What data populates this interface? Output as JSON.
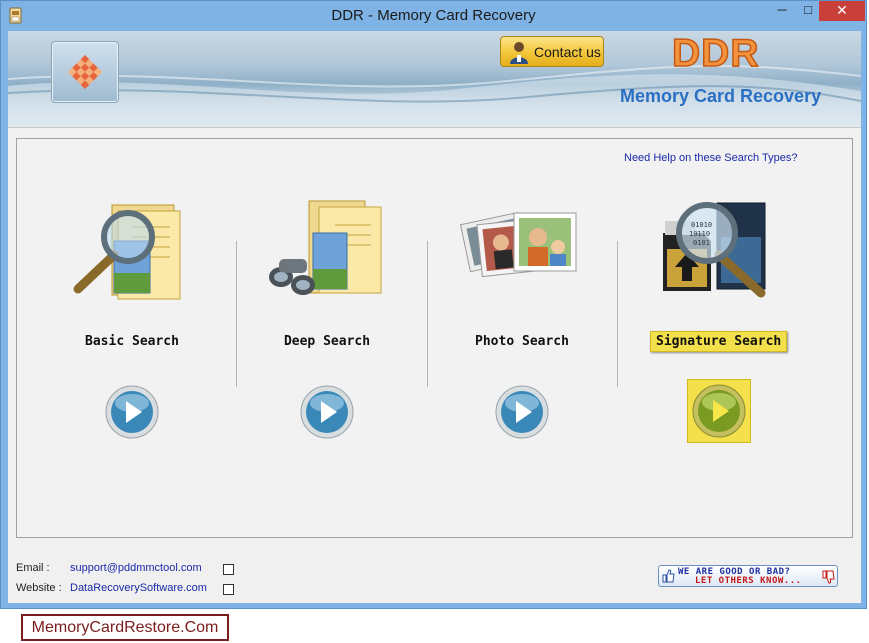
{
  "window": {
    "title": "DDR - Memory Card Recovery",
    "minimize": "─",
    "maximize": "□",
    "close": "✕"
  },
  "header": {
    "contact_label": "Contact us",
    "brand": "DDR",
    "product": "Memory Card Recovery",
    "logo_icon": "checkered-diamond-logo",
    "colors": {
      "brand": "#f5923e",
      "product": "#2b6fc4",
      "contact": "#f3c63a"
    }
  },
  "main": {
    "help_link": "Need Help on these Search Types?",
    "options": [
      {
        "label": "Basic Search",
        "icon": "magnifier-folder-icon",
        "selected": false
      },
      {
        "label": "Deep Search",
        "icon": "binoculars-folder-icon",
        "selected": false
      },
      {
        "label": "Photo Search",
        "icon": "photos-stack-icon",
        "selected": false
      },
      {
        "label": "Signature Search",
        "icon": "memory-card-magnifier-icon",
        "selected": true
      }
    ],
    "highlight_color": "#f3e04a"
  },
  "footer": {
    "email_label": "Email :",
    "email": "support@pddmmctool.com",
    "website_label": "Website :",
    "website": "DataRecoverySoftware.com",
    "feedback_line1": "WE ARE GOOD OR BAD?",
    "feedback_line2": "LET OTHERS KNOW..."
  },
  "watermark": "MemoryCardRestore.Com"
}
